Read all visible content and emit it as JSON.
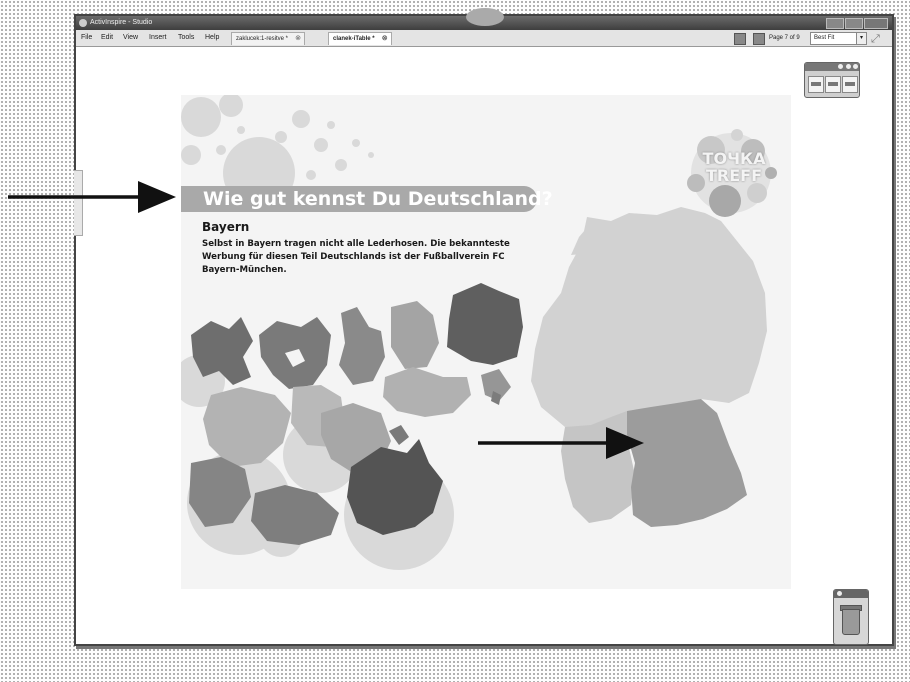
{
  "window": {
    "title": "ActivInspire - Studio"
  },
  "menu": {
    "items": [
      "File",
      "Edit",
      "View",
      "Insert",
      "Tools",
      "Help"
    ]
  },
  "tabs": [
    {
      "label": "zaklucek:1-resitve *",
      "close": "⊗"
    },
    {
      "label": "clanek-iTable *",
      "close": "⊗"
    }
  ],
  "toolbar": {
    "page_indicator": "Page 7 of 9",
    "zoom_value": "Best Fit",
    "dropdown_glyph": "▾",
    "resize_glyph": "⤢"
  },
  "slide": {
    "banner_title": "Wie gut kennst Du Deutschland?",
    "region_title": "Bayern",
    "description": "Selbst in Bayern tragen nicht alle Lederhosen. Die bekannteste Werbung für diesen Teil Deutschlands ist der Fußballverein FC Bayern-München.",
    "logo_line1": "ТОЧКА",
    "logo_line2": "TREFF"
  },
  "colors": {
    "banner": "#a9a9a9",
    "slide_bg": "#f4f4f4",
    "bavaria": "#9c9c9c",
    "germany": "#d2d2d2"
  },
  "icons": [
    "app-icon",
    "minimize-icon",
    "maximize-icon",
    "close-icon",
    "toolbox-icon",
    "trash-icon",
    "arrow-icon"
  ]
}
